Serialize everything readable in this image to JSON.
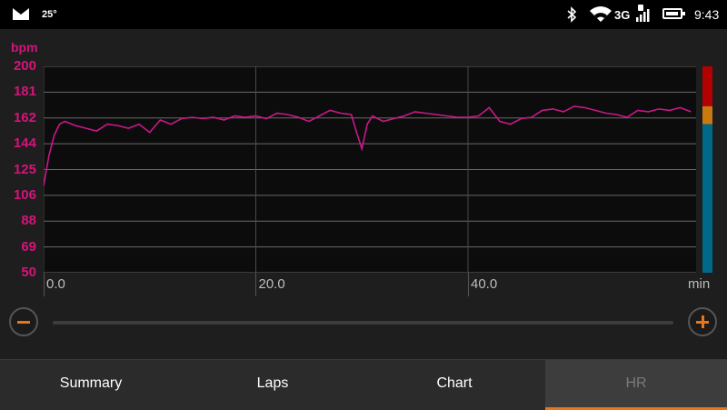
{
  "status_bar": {
    "temperature": "25°",
    "network": "3G",
    "time": "9:43",
    "icons": [
      "mail-icon",
      "bluetooth-icon",
      "wifi-icon",
      "signal-icon",
      "battery-icon"
    ]
  },
  "chart_data": {
    "type": "line",
    "ylabel": "bpm",
    "xlabel": "min",
    "y_ticks": [
      "200",
      "181",
      "162",
      "144",
      "125",
      "106",
      "88",
      "69",
      "50"
    ],
    "x_ticks": [
      "0.0",
      "20.0",
      "40.0"
    ],
    "ylim": [
      50,
      200
    ],
    "xlim": [
      0,
      61.5
    ],
    "grid": true,
    "series": [
      {
        "color": "#c81888",
        "x": [
          0,
          0.5,
          1,
          1.5,
          2,
          3,
          4,
          5,
          6,
          7,
          8,
          9,
          10,
          11,
          12,
          13,
          14,
          15,
          16,
          17,
          18,
          19,
          20,
          21,
          22,
          23,
          24,
          25,
          26,
          27,
          28,
          29,
          29.5,
          30,
          30.5,
          31,
          32,
          33,
          34,
          35,
          36,
          37,
          38,
          39,
          40,
          41,
          42,
          43,
          44,
          45,
          46,
          47,
          48,
          49,
          50,
          51,
          52,
          53,
          54,
          55,
          56,
          57,
          58,
          59,
          60,
          61
        ],
        "y": [
          113,
          135,
          150,
          158,
          160,
          157,
          155,
          153,
          158,
          157,
          155,
          158,
          152,
          161,
          158,
          162,
          163,
          162,
          163,
          161,
          164,
          163,
          164,
          162,
          166,
          165,
          163,
          160,
          164,
          168,
          166,
          165,
          152,
          140,
          158,
          164,
          160,
          162,
          164,
          167,
          166,
          165,
          164,
          163,
          163,
          164,
          170,
          160,
          158,
          162,
          163,
          168,
          169,
          167,
          171,
          170,
          168,
          166,
          165,
          163,
          168,
          167,
          169,
          168,
          170,
          167
        ]
      }
    ],
    "zones": [
      {
        "color": "#b30000",
        "from": 171,
        "to": 200
      },
      {
        "color": "#c87a10",
        "from": 158,
        "to": 171
      },
      {
        "color": "#00698a",
        "from": 50,
        "to": 158
      }
    ]
  },
  "tabs": [
    {
      "label": "Summary"
    },
    {
      "label": "Laps"
    },
    {
      "label": "Chart"
    },
    {
      "label": "HR",
      "active": true
    }
  ],
  "colors": {
    "accent": "#e8751a",
    "line": "#c81888",
    "axis_label": "#d4147a"
  }
}
